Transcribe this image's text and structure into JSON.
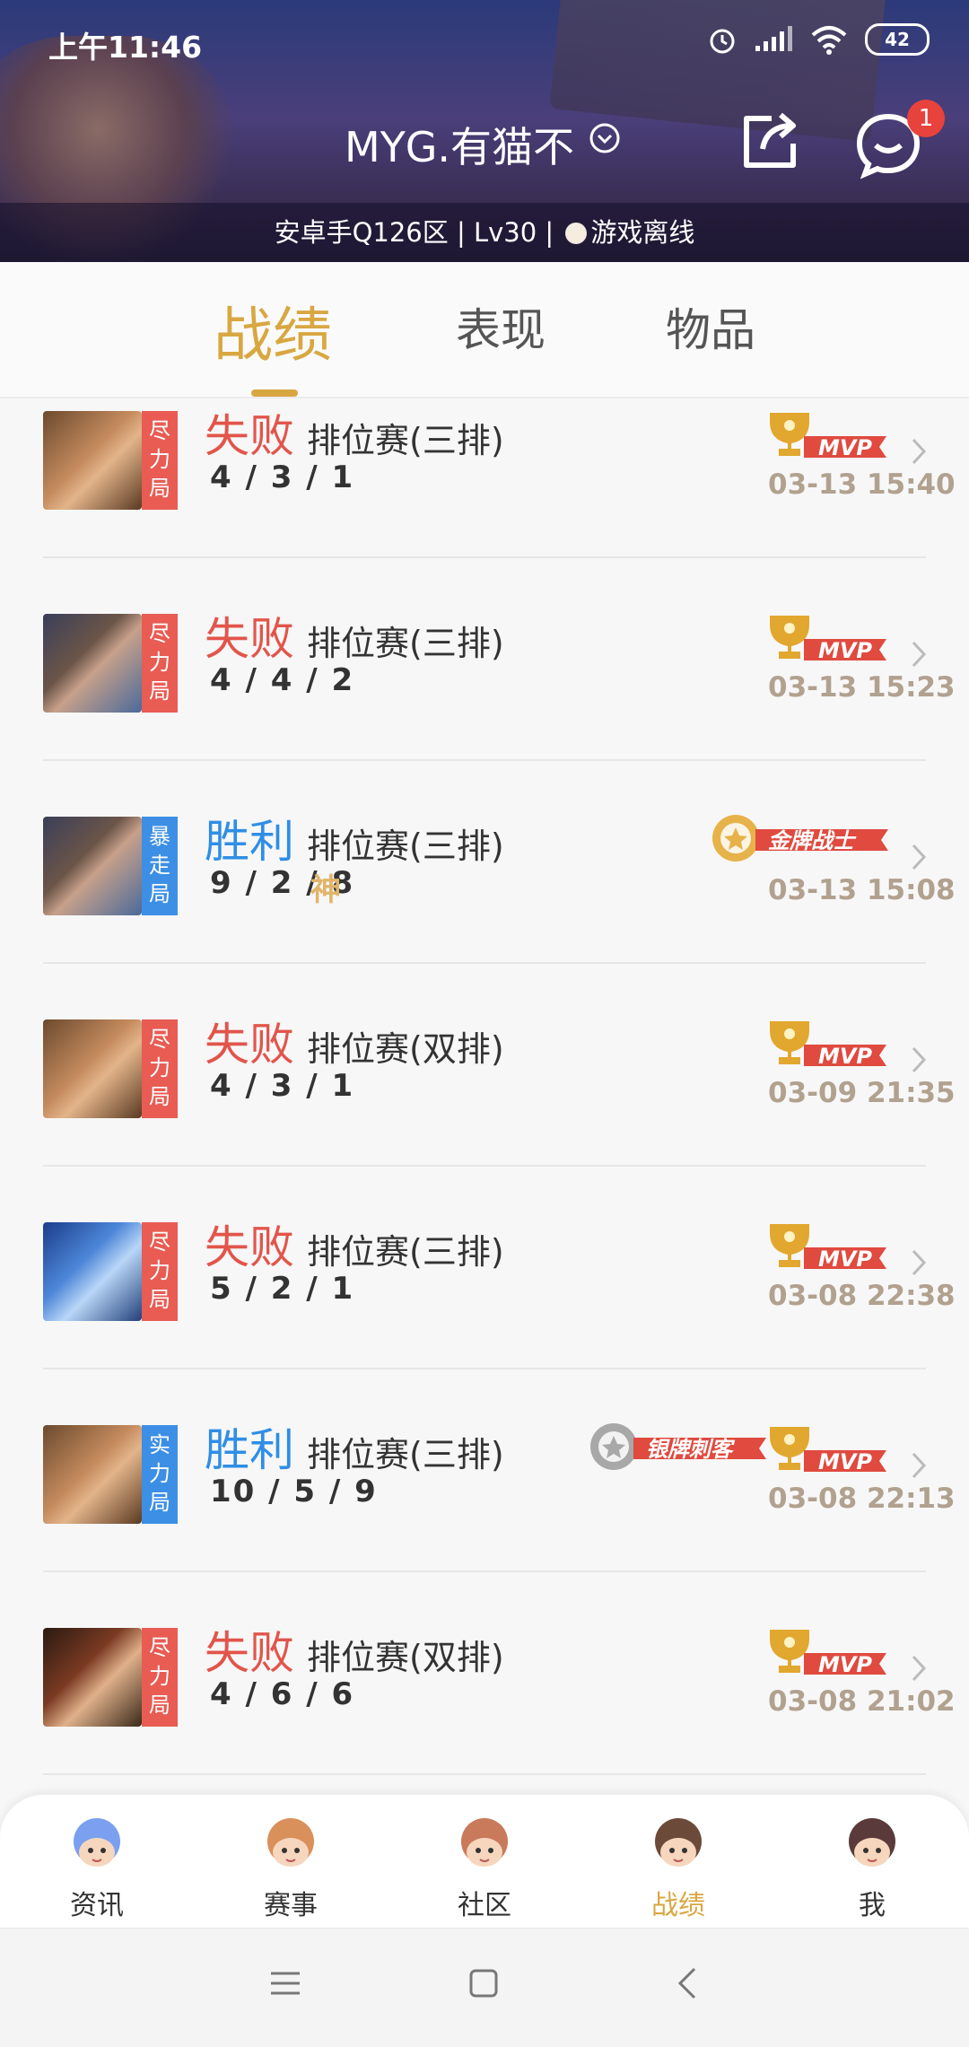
{
  "status_bar": {
    "time": "上午11:46",
    "battery": "42"
  },
  "header": {
    "title": "MYG.有猫不",
    "subinfo": "安卓手Q126区 | Lv30 |",
    "status": "游戏离线",
    "message_badge": "1"
  },
  "tabs": [
    {
      "label": "战绩",
      "active": true
    },
    {
      "label": "表现",
      "active": false
    },
    {
      "label": "物品",
      "active": false
    }
  ],
  "matches": [
    {
      "tag": "尽力局",
      "tag_color": "#e85c53",
      "result": "失败",
      "mode": "排位赛(三排)",
      "kda": "4 / 3 / 1",
      "extra": "",
      "time": "03-13 15:40",
      "badges": [
        "MVP"
      ],
      "hero": "hero-brown"
    },
    {
      "tag": "尽力局",
      "tag_color": "#e85c53",
      "result": "失败",
      "mode": "排位赛(三排)",
      "kda": "4 / 4 / 2",
      "extra": "",
      "time": "03-13 15:23",
      "badges": [
        "MVP"
      ],
      "hero": "hero-blue-brown"
    },
    {
      "tag": "暴走局",
      "tag_color": "#3d8fe5",
      "result": "胜利",
      "mode": "排位赛(三排)",
      "kda": "9 / 2 / 8",
      "extra": "神",
      "time": "03-13 15:08",
      "badges": [
        "金牌战士"
      ],
      "hero": "hero-blue-brown"
    },
    {
      "tag": "尽力局",
      "tag_color": "#e85c53",
      "result": "失败",
      "mode": "排位赛(双排)",
      "kda": "4 / 3 / 1",
      "extra": "",
      "time": "03-09 21:35",
      "badges": [
        "MVP"
      ],
      "hero": "hero-brown"
    },
    {
      "tag": "尽力局",
      "tag_color": "#e85c53",
      "result": "失败",
      "mode": "排位赛(三排)",
      "kda": "5 / 2 / 1",
      "extra": "",
      "time": "03-08 22:38",
      "badges": [
        "MVP"
      ],
      "hero": "hero-blue"
    },
    {
      "tag": "实力局",
      "tag_color": "#3d8fe5",
      "result": "胜利",
      "mode": "排位赛(三排)",
      "kda": "10 / 5 / 9",
      "extra": "",
      "time": "03-08 22:13",
      "badges": [
        "银牌刺客",
        "MVP"
      ],
      "hero": "hero-brown"
    },
    {
      "tag": "尽力局",
      "tag_color": "#e85c53",
      "result": "失败",
      "mode": "排位赛(双排)",
      "kda": "4 / 6 / 6",
      "extra": "",
      "time": "03-08 21:02",
      "badges": [
        "MVP"
      ],
      "hero": "hero-dark"
    }
  ],
  "bottom_nav": [
    {
      "label": "资讯",
      "icon": "news-avatar-icon",
      "active": false
    },
    {
      "label": "赛事",
      "icon": "events-avatar-icon",
      "active": false
    },
    {
      "label": "社区",
      "icon": "community-avatar-icon",
      "active": false
    },
    {
      "label": "战绩",
      "icon": "records-avatar-icon",
      "active": true
    },
    {
      "label": "我",
      "icon": "me-avatar-icon",
      "active": false
    }
  ],
  "colors": {
    "accent": "#d9a741",
    "loss": "#e2554b",
    "win": "#2f8ee5",
    "time": "#b1a18f"
  }
}
